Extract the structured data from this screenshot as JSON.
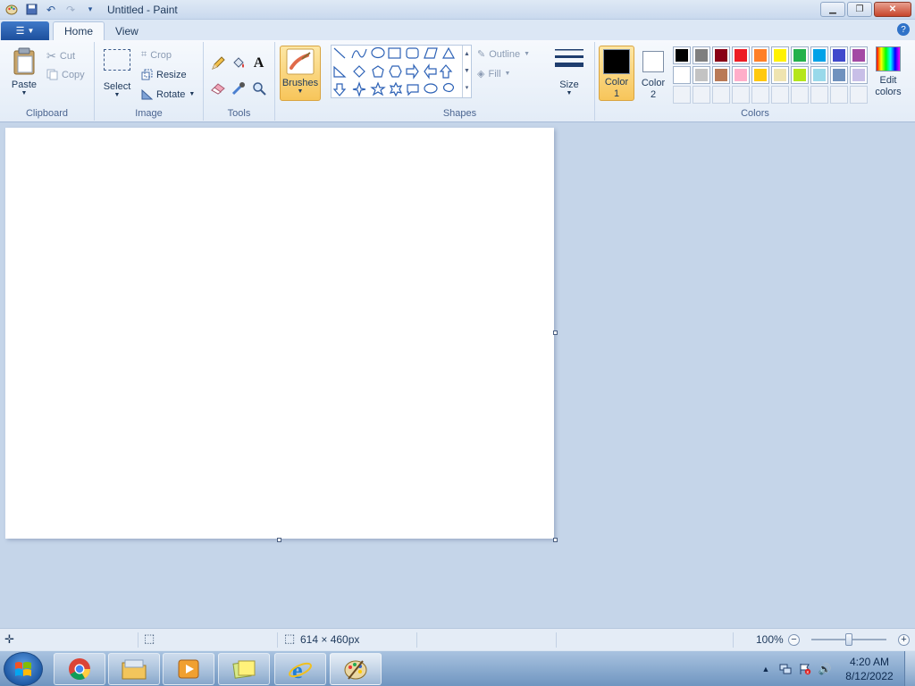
{
  "window": {
    "title": "Untitled - Paint"
  },
  "tabs": [
    {
      "label": "Home",
      "active": true
    },
    {
      "label": "View",
      "active": false
    }
  ],
  "ribbon": {
    "clipboard": {
      "label": "Clipboard",
      "paste": "Paste",
      "cut": "Cut",
      "copy": "Copy"
    },
    "image": {
      "label": "Image",
      "select": "Select",
      "crop": "Crop",
      "resize": "Resize",
      "rotate": "Rotate"
    },
    "tools": {
      "label": "Tools"
    },
    "brushes": {
      "label": "Brushes"
    },
    "shapes": {
      "label": "Shapes",
      "outline": "Outline",
      "fill": "Fill"
    },
    "size": {
      "label": "Size"
    },
    "colors": {
      "label": "Colors",
      "color1": "Color",
      "color1_num": "1",
      "color2": "Color",
      "color2_num": "2",
      "color1_value": "#000000",
      "color2_value": "#ffffff",
      "edit": "Edit",
      "edit2": "colors",
      "palette_row1": [
        "#000000",
        "#7f7f7f",
        "#880015",
        "#ed1c24",
        "#ff7f27",
        "#fff200",
        "#22b14c",
        "#00a2e8",
        "#3f48cc",
        "#a349a4"
      ],
      "palette_row2": [
        "#ffffff",
        "#c3c3c3",
        "#b97a57",
        "#ffaec9",
        "#ffc90e",
        "#efe4b0",
        "#b5e61d",
        "#99d9ea",
        "#7092be",
        "#c8bfe7"
      ]
    }
  },
  "statusbar": {
    "canvas_size": "614 × 460px",
    "zoom": "100%"
  },
  "taskbar": {
    "time": "4:20 AM",
    "date": "8/12/2022"
  }
}
